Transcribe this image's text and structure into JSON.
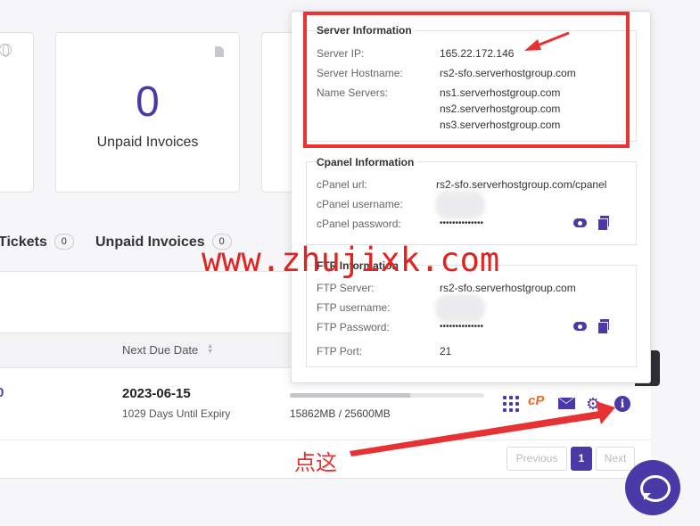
{
  "stat_cards": [
    {
      "value": "0",
      "label": "Unpaid Invoices"
    }
  ],
  "tabs": [
    {
      "label": "Tickets",
      "count": "0"
    },
    {
      "label": "Unpaid Invoices",
      "count": "0"
    }
  ],
  "table": {
    "columns": [
      "Next Due Date"
    ],
    "row": {
      "id_partial": "0",
      "due_date": "2023-06-15",
      "due_sub": "1029 Days Until Expiry",
      "usage": "15862MB / 25600MB",
      "usage_fraction": 0.62
    }
  },
  "pagination": {
    "previous": "Previous",
    "current": "1",
    "next": "Next"
  },
  "popover": {
    "server": {
      "title": "Server Information",
      "ip_label": "Server IP:",
      "ip": "165.22.172.146",
      "hostname_label": "Server Hostname:",
      "hostname": "rs2-sfo.serverhostgroup.com",
      "ns_label": "Name Servers:",
      "ns": [
        "ns1.serverhostgroup.com",
        "ns2.serverhostgroup.com",
        "ns3.serverhostgroup.com"
      ]
    },
    "cpanel": {
      "title": "Cpanel Information",
      "url_label": "cPanel url:",
      "url": "rs2-sfo.serverhostgroup.com/cpanel",
      "username_label": "cPanel username:",
      "password_label": "cPanel password:",
      "password": "••••••••••••••"
    },
    "ftp": {
      "title": "FTP Information",
      "server_label": "FTP Server:",
      "server": "rs2-sfo.serverhostgroup.com",
      "username_label": "FTP username:",
      "password_label": "FTP Password:",
      "password": "••••••••••••••",
      "port_label": "FTP Port:",
      "port": "21"
    }
  },
  "annotations": {
    "watermark": "www.zhujixk.com",
    "click_here": "点这",
    "highlight_color": "#ea3333"
  },
  "accent_color": "#4a3aa8",
  "icons": [
    "globe-icon",
    "document-icon",
    "grid-icon",
    "cpanel-icon",
    "mail-icon",
    "gear-icon",
    "info-icon",
    "eye-icon",
    "copy-icon",
    "chat-icon"
  ]
}
